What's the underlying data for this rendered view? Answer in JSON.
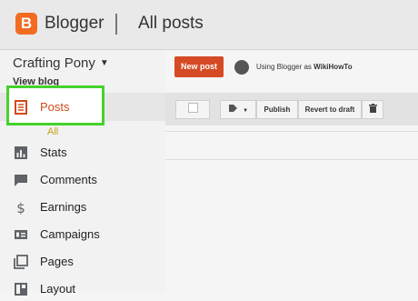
{
  "header": {
    "app_name": "Blogger",
    "page_title": "All posts",
    "logo_letter": "B",
    "brand_color": "#f26b21"
  },
  "sidebar": {
    "blog_name": "Crafting Pony",
    "view_blog": "View blog",
    "items": [
      {
        "label": "Posts",
        "icon": "posts-icon",
        "active": true
      },
      {
        "label": "All",
        "sub": true
      },
      {
        "label": "Stats",
        "icon": "stats-icon"
      },
      {
        "label": "Comments",
        "icon": "comments-icon"
      },
      {
        "label": "Earnings",
        "icon": "dollar-icon"
      },
      {
        "label": "Campaigns",
        "icon": "campaigns-icon"
      },
      {
        "label": "Pages",
        "icon": "pages-icon"
      },
      {
        "label": "Layout",
        "icon": "layout-icon"
      }
    ]
  },
  "main": {
    "new_post_label": "New post",
    "using_as_prefix": "Using Blogger as ",
    "using_as_user": "WikiHowTo",
    "toolbar": {
      "publish_label": "Publish",
      "revert_label": "Revert to draft"
    }
  },
  "colors": {
    "accent": "#d54a24",
    "highlight": "#44d22c",
    "sub_link": "#c9a21b"
  }
}
